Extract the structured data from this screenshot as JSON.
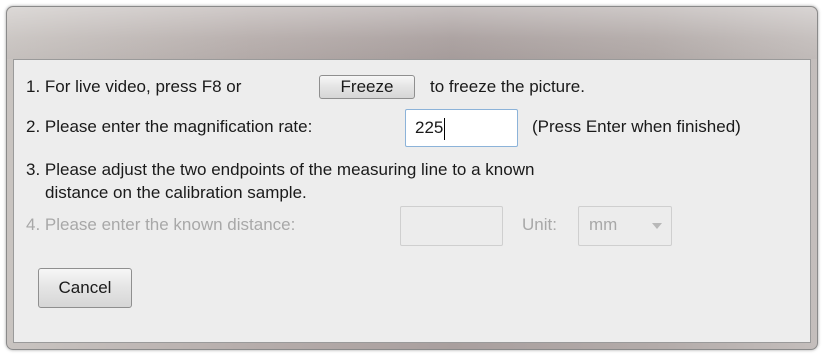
{
  "dialog": {
    "step1": {
      "prefix": "1. For live video, press F8 or",
      "button_label": "Freeze",
      "suffix": "to freeze the picture."
    },
    "step2": {
      "label": "2. Please enter the magnification rate:",
      "value": "225",
      "hint": "(Press Enter when finished)"
    },
    "step3": {
      "line1": "3. Please adjust the two endpoints of the measuring line to a known",
      "line2": "distance on the calibration sample."
    },
    "step4": {
      "label": "4. Please enter the known distance:",
      "value": "",
      "unit_label": "Unit:",
      "unit_selected": "mm"
    },
    "cancel_label": "Cancel"
  },
  "colors": {
    "accent_input_border": "#8cb3d9",
    "disabled_text": "#a8a8a8"
  },
  "icons": {
    "unit_dropdown": "chevron-down-icon"
  }
}
